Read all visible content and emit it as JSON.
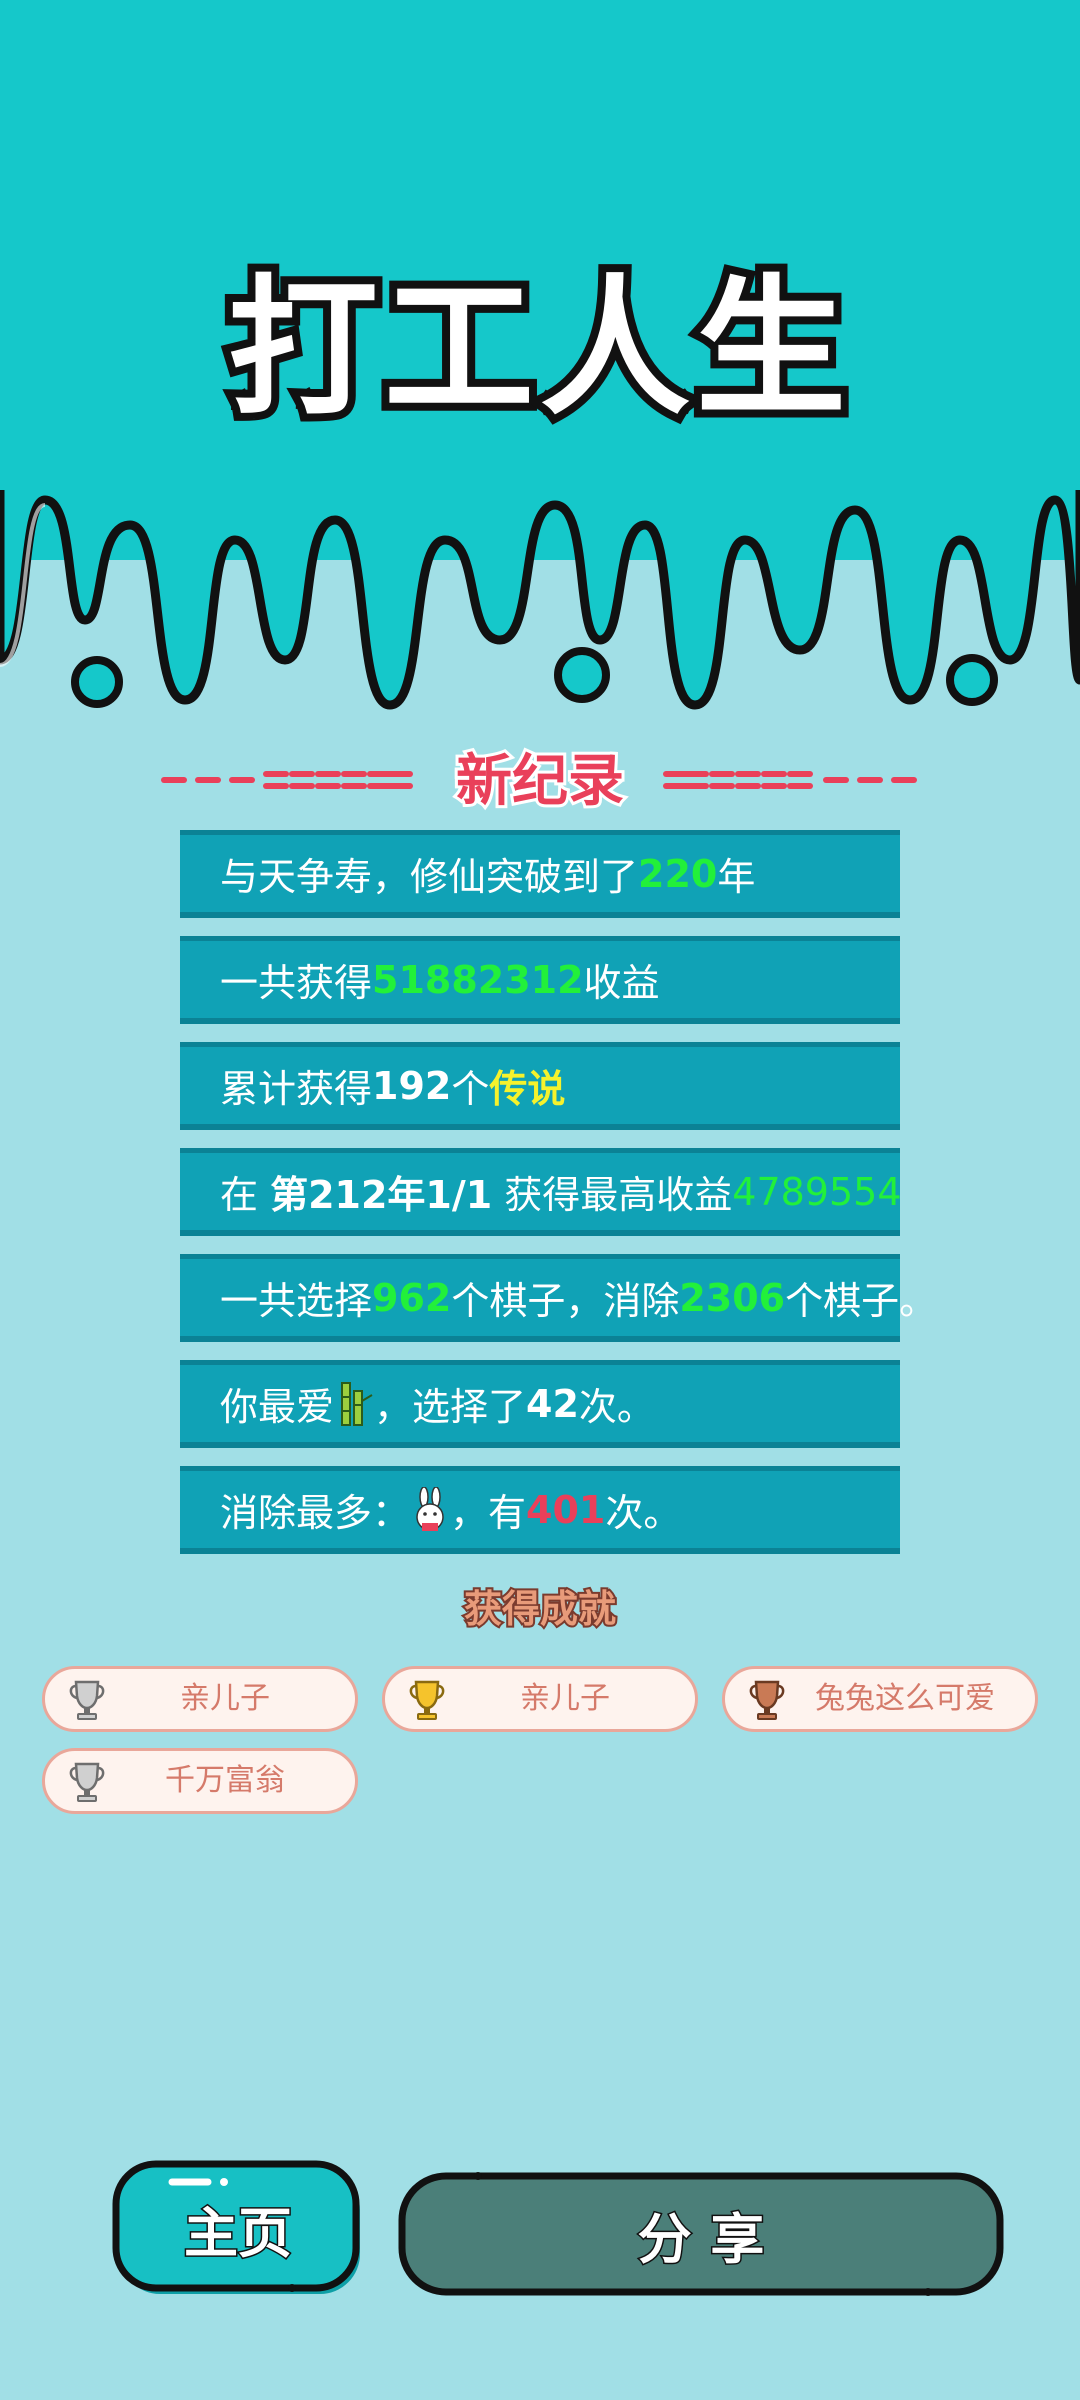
{
  "header": {
    "title": "打工人生"
  },
  "record": {
    "title": "新纪录",
    "left_deco": "- - - = = = = =",
    "right_deco": "= = = = = - - -",
    "lines": [
      {
        "parts": [
          {
            "text": "与天争寿，修仙突破到了",
            "style": "plain"
          },
          {
            "text": "220",
            "style": "green"
          },
          {
            "text": "年",
            "style": "plain"
          }
        ]
      },
      {
        "parts": [
          {
            "text": "一共获得",
            "style": "plain"
          },
          {
            "text": "51882312",
            "style": "green"
          },
          {
            "text": "收益",
            "style": "plain"
          }
        ]
      },
      {
        "parts": [
          {
            "text": "累计获得",
            "style": "plain"
          },
          {
            "text": "192",
            "style": "bold"
          },
          {
            "text": "个",
            "style": "plain"
          },
          {
            "text": "传说",
            "style": "yellow"
          }
        ]
      },
      {
        "parts": [
          {
            "text": "在 ",
            "style": "plain"
          },
          {
            "text": "第212年1/1",
            "style": "bold"
          },
          {
            "text": " 获得最高收益",
            "style": "plain"
          },
          {
            "text": "4789554",
            "style": "green-light"
          }
        ]
      },
      {
        "parts": [
          {
            "text": "一共选择",
            "style": "plain"
          },
          {
            "text": "962",
            "style": "green"
          },
          {
            "text": "个棋子，消除",
            "style": "plain"
          },
          {
            "text": "2306",
            "style": "green"
          },
          {
            "text": "个棋子。",
            "style": "plain"
          }
        ]
      },
      {
        "parts": [
          {
            "text": "你最爱",
            "style": "plain"
          },
          {
            "icon": "bamboo-icon"
          },
          {
            "text": "，选择了",
            "style": "plain"
          },
          {
            "text": "42",
            "style": "bold"
          },
          {
            "text": "次。",
            "style": "plain"
          }
        ]
      },
      {
        "parts": [
          {
            "text": "消除最多：",
            "style": "plain"
          },
          {
            "icon": "rabbit-icon"
          },
          {
            "text": "，有",
            "style": "plain"
          },
          {
            "text": "401",
            "style": "red"
          },
          {
            "text": "次。",
            "style": "plain"
          }
        ]
      }
    ]
  },
  "achievements": {
    "title": "获得成就",
    "items": [
      {
        "label": "亲儿子",
        "trophy": "silver-trophy-icon"
      },
      {
        "label": "亲儿子",
        "trophy": "gold-trophy-icon"
      },
      {
        "label": "兔兔这么可爱",
        "trophy": "bronze-trophy-icon"
      },
      {
        "label": "千万富翁",
        "trophy": "silver-trophy-icon"
      }
    ]
  },
  "buttons": {
    "home": "主页",
    "share": "分 享"
  },
  "colors": {
    "top_background": "#15c8ca",
    "page_background": "#a1dfe6",
    "panel": "#10a2b6",
    "highlight_green": "#22f03a",
    "highlight_yellow": "#f5f22c",
    "highlight_red": "#e9405a",
    "record_title": "#e9405a",
    "home_button": "#17c0c4",
    "share_button": "#4b7f79"
  }
}
